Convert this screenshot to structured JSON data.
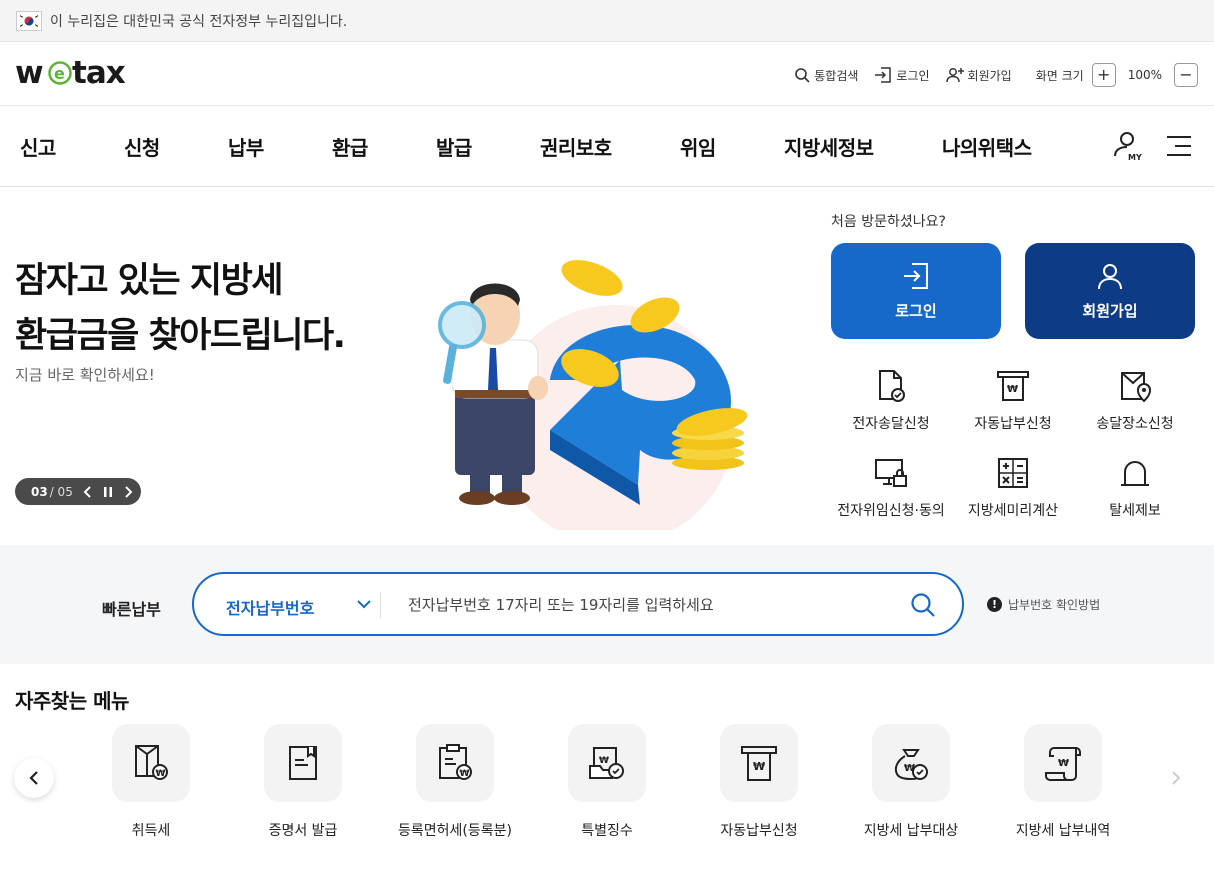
{
  "gov_banner": {
    "text": "이 누리집은 대한민국 공식 전자정부 누리집입니다."
  },
  "header": {
    "logo": "wetax",
    "util": {
      "search": "통합검색",
      "login": "로그인",
      "join": "회원가입",
      "zoom_label": "화면 크기",
      "zoom_in": "+",
      "zoom_value": "100%",
      "zoom_out": "−"
    }
  },
  "gnb": {
    "items": [
      "신고",
      "신청",
      "납부",
      "환급",
      "발급",
      "권리보호",
      "위임",
      "지방세정보",
      "나의위택스"
    ],
    "my_label": "MY"
  },
  "hero": {
    "title_line1": "잠자고 있는 지방세",
    "title_line2": "환급금을 찾아드립니다.",
    "subtitle": "지금 바로 확인하세요!",
    "pager_current": "03",
    "pager_total": "/ 05"
  },
  "side": {
    "visit_question": "처음 방문하셨나요?",
    "login": "로그인",
    "join": "회원가입",
    "quick": [
      "전자송달신청",
      "자동납부신청",
      "송달장소신청",
      "전자위임신청·동의",
      "지방세미리계산",
      "탈세제보"
    ]
  },
  "fast_pay": {
    "label": "빠른납부",
    "select_value": "전자납부번호",
    "placeholder": "전자납부번호 17자리 또는 19자리를 입력하세요",
    "help": "납부번호 확인방법"
  },
  "frequent": {
    "title": "자주찾는 메뉴",
    "items": [
      "취득세",
      "증명서 발급",
      "등록면허세(등록분)",
      "특별징수",
      "자동납부신청",
      "지방세 납부대상",
      "지방세 납부내역"
    ]
  },
  "colors": {
    "primary": "#1669c9",
    "navy": "#0d3b85",
    "logo_green": "#5bb532"
  }
}
